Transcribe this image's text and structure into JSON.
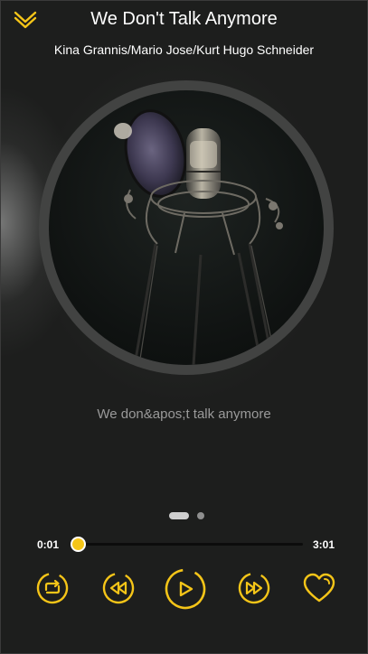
{
  "header": {
    "title": "We Don't Talk Anymore",
    "artist": "Kina Grannis/Mario Jose/Kurt Hugo Schneider"
  },
  "lyrics": {
    "current_line": "We don&apos;t talk anymore"
  },
  "pager": {
    "page_count": 2,
    "active_page": 1
  },
  "playback": {
    "current_time": "0:01",
    "total_time": "3:01",
    "progress_fraction": 0.006
  },
  "controls": {
    "collapse_icon": "chevron-down-icon",
    "repeat_icon": "repeat-icon",
    "previous_icon": "rewind-icon",
    "play_icon": "play-icon",
    "next_icon": "fast-forward-icon",
    "favorite_icon": "heart-icon"
  },
  "theme": {
    "accent": "#f5c518",
    "background": "#1c1d1c",
    "lyric_color": "#9a9a9a"
  }
}
